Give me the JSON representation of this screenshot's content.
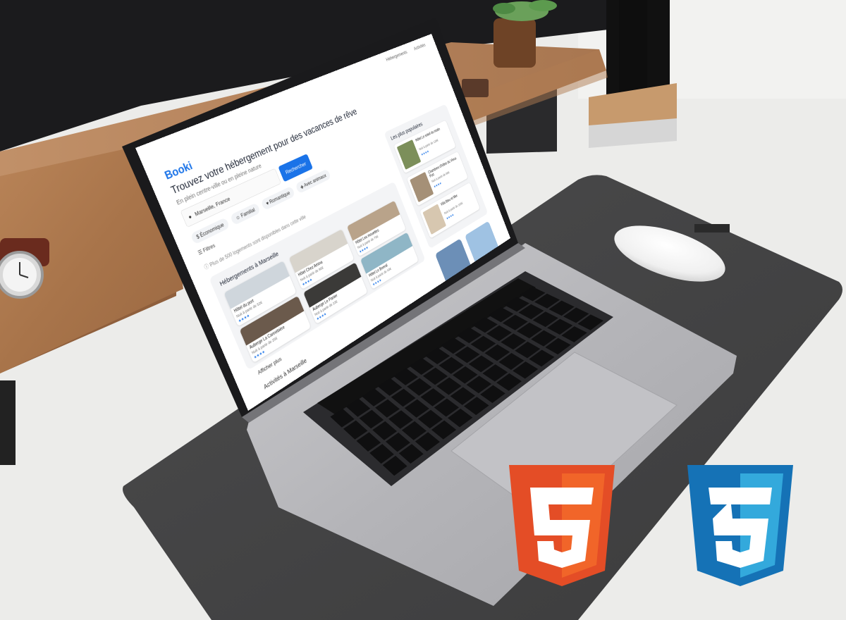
{
  "screen": {
    "nav": [
      "Hébergements",
      "Activités"
    ],
    "logo": "Booki",
    "title": "Trouvez votre hébergement pour des vacances de rêve",
    "subtitle": "En plein centre-ville ou en pleine nature",
    "search_value": "Marseille, France",
    "search_button": "Rechercher",
    "chips": [
      "Économique",
      "Familial",
      "Romantique",
      "Avec animaux"
    ],
    "filters_label": "Filtres",
    "info_text": "Plus de 500 logements sont disponibles dans cette ville",
    "accommodations_title": "Hébergements à Marseille",
    "accommodations": [
      {
        "name": "Hôtel du port",
        "price": "Nuit à partir de 52€",
        "stars": "★★★★"
      },
      {
        "name": "Hôtel Chez Amina",
        "price": "Nuit à partir de 96€",
        "stars": "★★★★"
      },
      {
        "name": "Hôtel Les mouettes",
        "price": "Nuit à partir de 76€",
        "stars": "★★★★"
      },
      {
        "name": "Auberge La Cannebière",
        "price": "Nuit à partir de 25€",
        "stars": "★★★★"
      },
      {
        "name": "Auberge Le Panier",
        "price": "Nuit à partir de 23€",
        "stars": "★★★★"
      },
      {
        "name": "Hôtel Le Boreal",
        "price": "Nuit à partir de 43€",
        "stars": "★★★★"
      }
    ],
    "popular_title": "Les plus populaires",
    "popular": [
      {
        "name": "Hôtel Le soleil du matin",
        "price": "Nuit à partir de 128€",
        "stars": "★★★★"
      },
      {
        "name": "Chambres d'hôtes du Vieux Port",
        "price": "Nuit à partir de 88€",
        "stars": "★★★★"
      },
      {
        "name": "Villa Bleu et Mer",
        "price": "Nuit à partir de 168€",
        "stars": "★★★★"
      }
    ],
    "show_more": "Afficher plus",
    "activities_title": "Activités à Marseille"
  },
  "colors": {
    "accent": "#1a73e8",
    "html5_orange": "#e44d26",
    "css3_blue": "#1572b6"
  },
  "icons": [
    "html5-logo",
    "css3-logo",
    "location-icon",
    "money-icon",
    "family-icon",
    "heart-icon",
    "paw-icon",
    "filter-icon",
    "info-icon"
  ]
}
